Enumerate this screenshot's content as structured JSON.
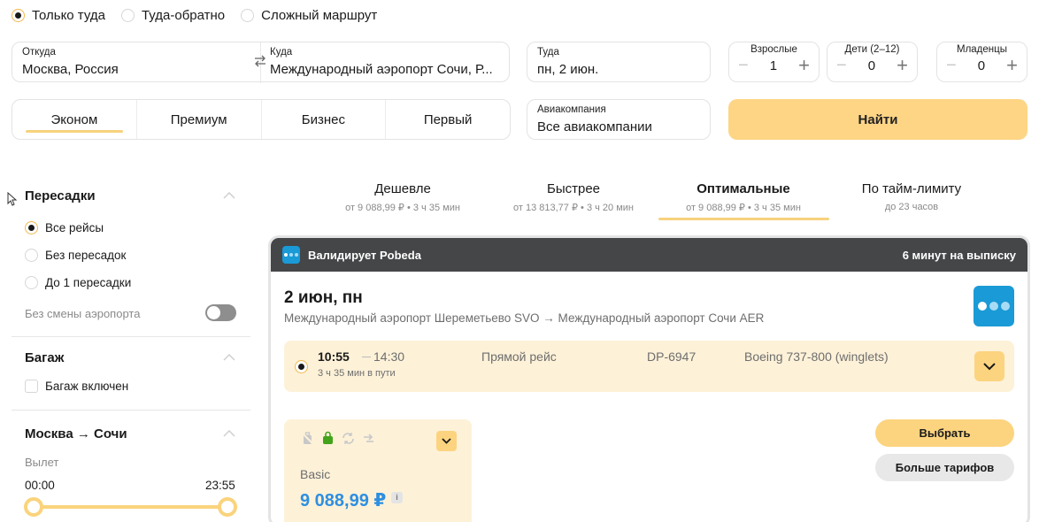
{
  "trip_types": [
    {
      "label": "Только туда",
      "selected": true
    },
    {
      "label": "Туда-обратно",
      "selected": false
    },
    {
      "label": "Сложный маршрут",
      "selected": false
    }
  ],
  "search": {
    "from_label": "Откуда",
    "from_value": "Москва, Россия",
    "to_label": "Куда",
    "to_value": "Международный аэропорт Сочи, Р...",
    "date_label": "Туда",
    "date_value": "пн, 2 июн.",
    "adults_label": "Взрослые",
    "adults_value": "1",
    "children_label": "Дети (2–12)",
    "children_value": "0",
    "infants_label": "Младенцы",
    "infants_value": "0",
    "classes": [
      "Эконом",
      "Премиум",
      "Бизнес",
      "Первый"
    ],
    "active_class": "Эконом",
    "airline_label": "Авиакомпания",
    "airline_value": "Все авиакомпании",
    "find_label": "Найти"
  },
  "filters": {
    "transfers_title": "Пересадки",
    "transfer_options": [
      {
        "label": "Все рейсы",
        "selected": true
      },
      {
        "label": "Без пересадок",
        "selected": false
      },
      {
        "label": "До 1 пересадки",
        "selected": false
      }
    ],
    "no_airport_change_label": "Без смены аэропорта",
    "no_airport_change_on": false,
    "baggage_title": "Багаж",
    "baggage_included_label": "Багаж включен",
    "route_title": "Москва → Сочи",
    "departure_label": "Вылет",
    "time_from": "00:00",
    "time_to": "23:55"
  },
  "sort_tabs": [
    {
      "title": "Дешевле",
      "sub": "от 9 088,99 ₽ • 3 ч 35 мин",
      "active": false
    },
    {
      "title": "Быстрее",
      "sub": "от 13 813,77 ₽ • 3 ч 20 мин",
      "active": false
    },
    {
      "title": "Оптимальные",
      "sub": "от 9 088,99 ₽ • 3 ч 35 мин",
      "active": true
    },
    {
      "title": "По тайм-лимиту",
      "sub": "до 23 часов",
      "active": false
    }
  ],
  "result": {
    "validator": "Валидирует Pobeda",
    "time_limit": "6 минут на выписку",
    "date": "2 июн, пн",
    "route": "Международный аэропорт Шереметьево SVO → Международный аэропорт Сочи AER",
    "segment": {
      "departure": "10:55",
      "arrival": "14:30",
      "duration": "3 ч 35 мин в пути",
      "type": "Прямой рейс",
      "flight_number": "DP-6947",
      "aircraft": "Boeing 737-800 (winglets)"
    },
    "fare": {
      "name": "Basic",
      "price": "9 088,99 ₽",
      "info": "i"
    },
    "select_label": "Выбрать",
    "more_fares_label": "Больше тарифов"
  },
  "colors": {
    "accent": "#fcd47f",
    "accent_light": "#fdf1d8",
    "price": "#2e8fe0",
    "header_dark": "#444648",
    "airline_brand": "#1a9ad6"
  }
}
